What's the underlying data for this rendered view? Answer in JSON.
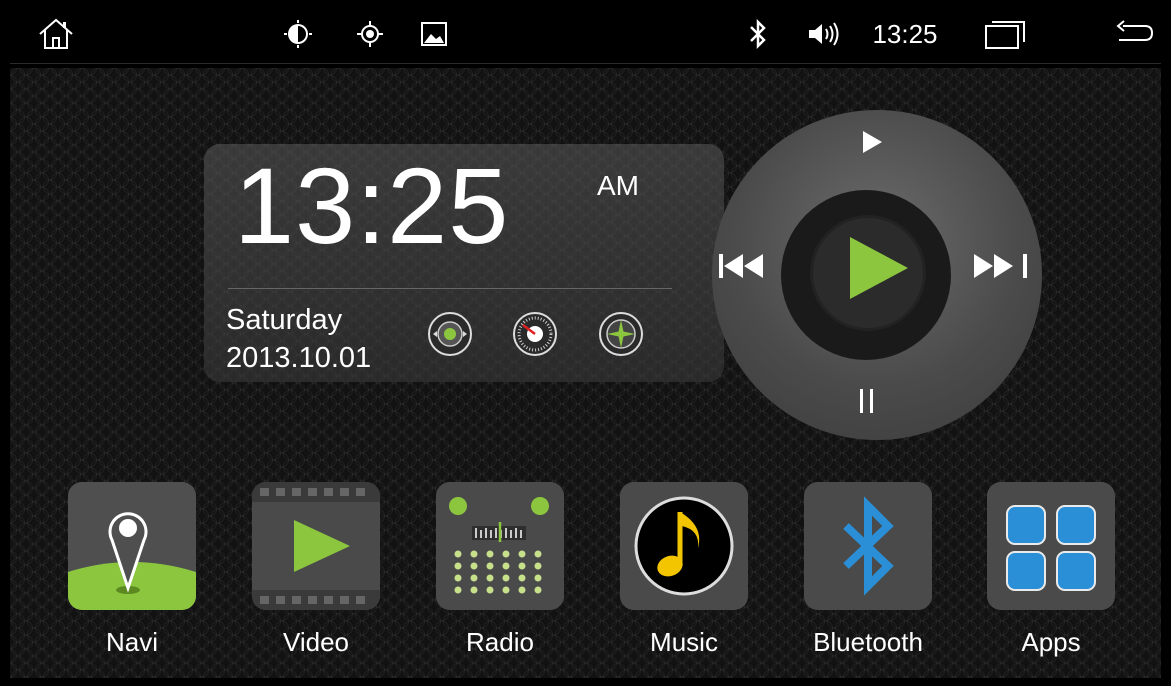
{
  "status_bar": {
    "time": "13:25",
    "icons": [
      "home-icon",
      "brightness-icon",
      "gps-icon",
      "wallpaper-icon",
      "bluetooth-icon",
      "volume-icon",
      "recent-apps-icon",
      "back-icon"
    ]
  },
  "clock": {
    "time": "13:25",
    "ampm": "AM",
    "day": "Saturday",
    "date": "2013.10.01",
    "gauges": [
      "radio-gauge-icon",
      "speedometer-icon",
      "compass-icon"
    ]
  },
  "player": {
    "controls": [
      "play-small",
      "previous",
      "play",
      "next",
      "pause"
    ]
  },
  "apps": [
    {
      "label": "Navi"
    },
    {
      "label": "Video"
    },
    {
      "label": "Radio"
    },
    {
      "label": "Music"
    },
    {
      "label": "Bluetooth"
    },
    {
      "label": "Apps"
    }
  ],
  "colors": {
    "accent_green": "#8cc63f",
    "bluetooth_blue": "#2b8fd8",
    "music_yellow": "#f2c500",
    "tile_gray": "#4a4a4a"
  }
}
